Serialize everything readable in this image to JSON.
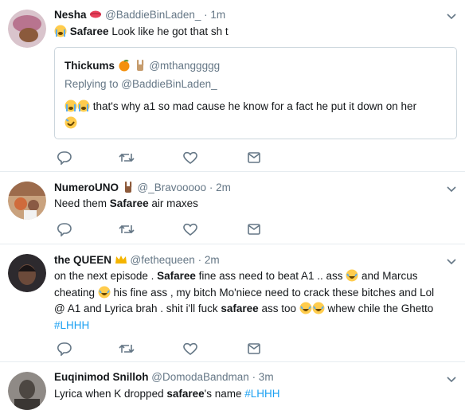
{
  "tweets": [
    {
      "name": "Nesha",
      "handle": "@BaddieBinLaden_",
      "time": "· 1m",
      "name_emoji": "kiss-lips-icon",
      "text_bold": "Safaree",
      "text_rest": " Look like he got that sh t",
      "quote": {
        "name": "Thickums",
        "handle": "@mthanggggg",
        "replying_prefix": "Replying to ",
        "replying_handle": "@BaddieBinLaden_",
        "text": " that's why a1 so mad cause he know for a fact he put it down on her"
      }
    },
    {
      "name": "NumeroUNO",
      "handle": "@_Bravooooo",
      "time": "· 2m",
      "text_prefix": "Need them ",
      "text_bold": "Safaree",
      "text_suffix": " air maxes"
    },
    {
      "name": "the QUEEN",
      "handle": "@fethequeen",
      "time": "· 2m",
      "line1_a": "on the next episode . ",
      "line1_bold": "Safaree",
      "line1_b": " fine ass need to beat A1 .. ass ",
      "line1_c": " and Marcus",
      "line2_a": "cheating ",
      "line2_b": " his fine ass , my bitch Mo'niece need to crack these bitches and Lol",
      "line3_a": "@ A1 and Lyrica brah . shit i'll fuck ",
      "line3_bold": "safaree",
      "line3_b": " ass too ",
      "line3_c": " whew chile the Ghetto",
      "hashtag": "#LHHH"
    },
    {
      "name": "Euqinimod Snilloh",
      "handle": "@DomodaBandman",
      "time": "· 3m",
      "text_prefix": "Lyrica when K dropped ",
      "text_bold": "safaree",
      "text_suffix": "'s name ",
      "hashtag": "#LHHH"
    }
  ],
  "colors": {
    "reply": "#1da1f2",
    "icon": "#657786",
    "border": "#e6ecf0"
  }
}
